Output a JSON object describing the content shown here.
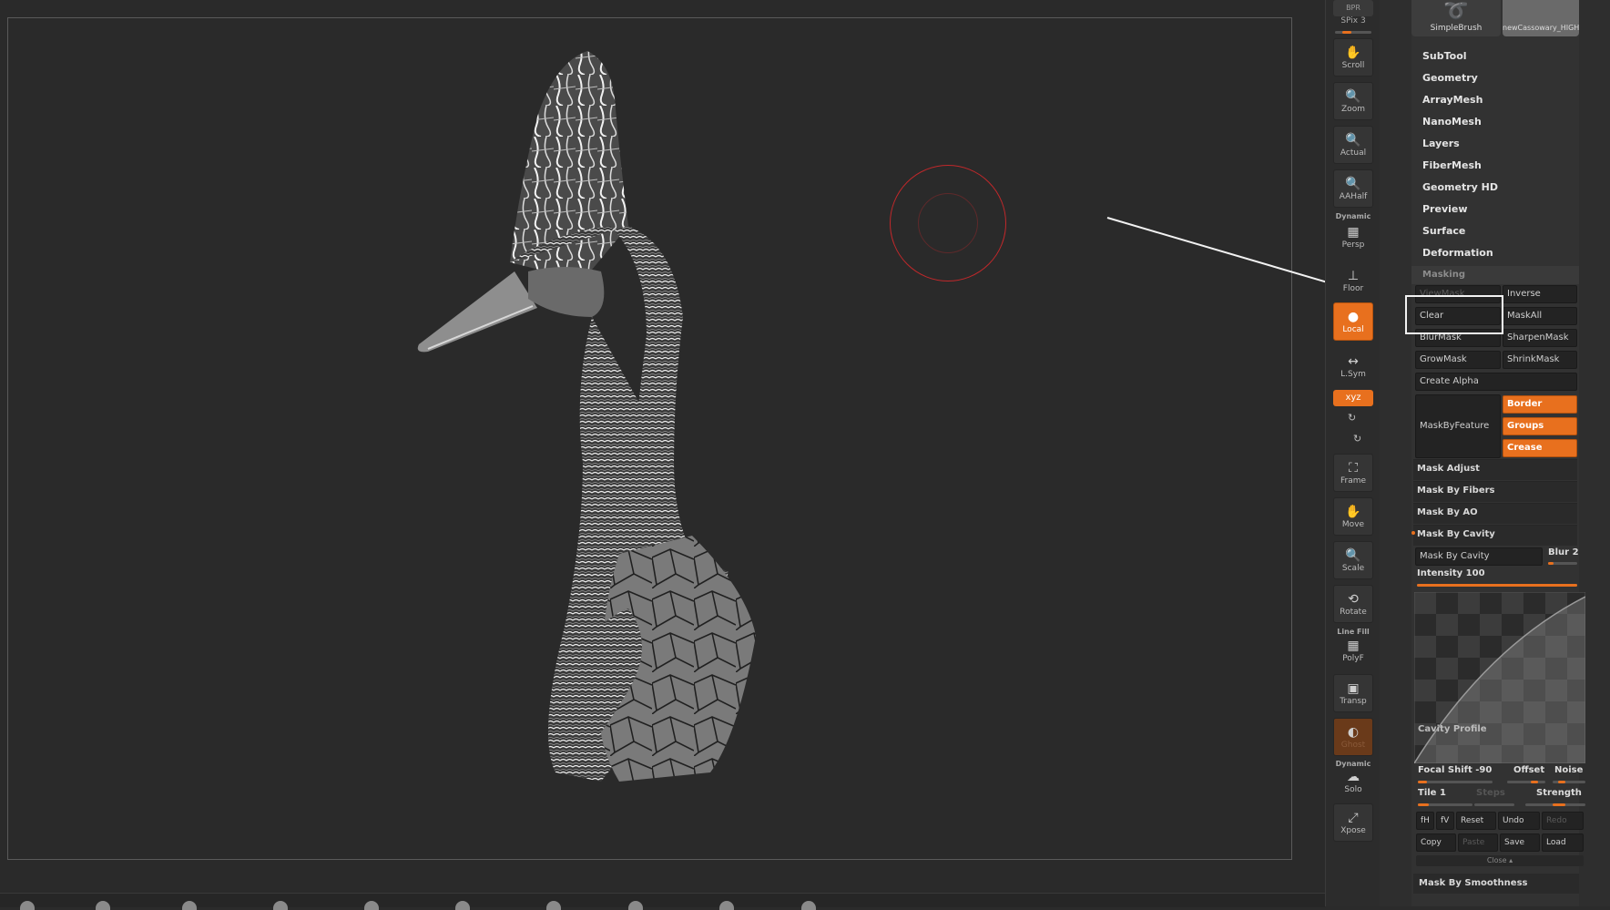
{
  "toolbar": {
    "bpr": "BPR",
    "spix": "SPix 3",
    "buttons": [
      "Scroll",
      "Zoom",
      "Actual",
      "AAHalf",
      "Persp",
      "Floor",
      "Local",
      "L.Sym",
      "xyz",
      "Frame",
      "Move",
      "Scale",
      "Rotate",
      "PolyF",
      "Transp",
      "Ghost",
      "Solo",
      "Xpose"
    ],
    "dynamic_label": "Dynamic",
    "line_fill_label": "Line Fill",
    "dynamic_label_2": "Dynamic"
  },
  "palette": {
    "thumbs": [
      "SimpleBrush",
      "newCassowary_HIGH"
    ],
    "menu": [
      "SubTool",
      "Geometry",
      "ArrayMesh",
      "NanoMesh",
      "Layers",
      "FiberMesh",
      "Geometry HD",
      "Preview",
      "Surface",
      "Deformation"
    ],
    "masking": {
      "title": "Masking",
      "view_mask": "ViewMask",
      "inverse": "Inverse",
      "clear": "Clear",
      "mask_all": "MaskAll",
      "blur_mask": "BlurMask",
      "sharpen_mask": "SharpenMask",
      "grow_mask": "GrowMask",
      "shrink_mask": "ShrinkMask",
      "create_alpha": "Create Alpha",
      "mask_by_feature": "MaskByFeature",
      "border": "Border",
      "groups": "Groups",
      "crease": "Crease",
      "mask_adjust": "Mask Adjust",
      "mask_by_fibers": "Mask By Fibers",
      "mask_by_ao": "Mask By AO",
      "mask_by_cavity_header": "Mask By Cavity",
      "mask_by_cavity_button": "Mask By Cavity",
      "blur": "Blur 2",
      "blur_value": 0.2,
      "intensity": "Intensity 100",
      "intensity_value": 1.0,
      "cavity_profile": "Cavity Profile",
      "focal_shift": "Focal Shift -90",
      "offset": "Offset",
      "noise": "Noise",
      "tile": "Tile 1",
      "steps": "Steps",
      "strength": "Strength",
      "fh": "fH",
      "fv": "fV",
      "reset": "Reset",
      "undo": "Undo",
      "redo": "Redo",
      "copy": "Copy",
      "paste": "Paste",
      "save": "Save",
      "load": "Load",
      "close": "Close",
      "mask_by_smoothness": "Mask By Smoothness"
    }
  },
  "colors": {
    "accent": "#e8701e",
    "cursor": "#c0282a"
  }
}
